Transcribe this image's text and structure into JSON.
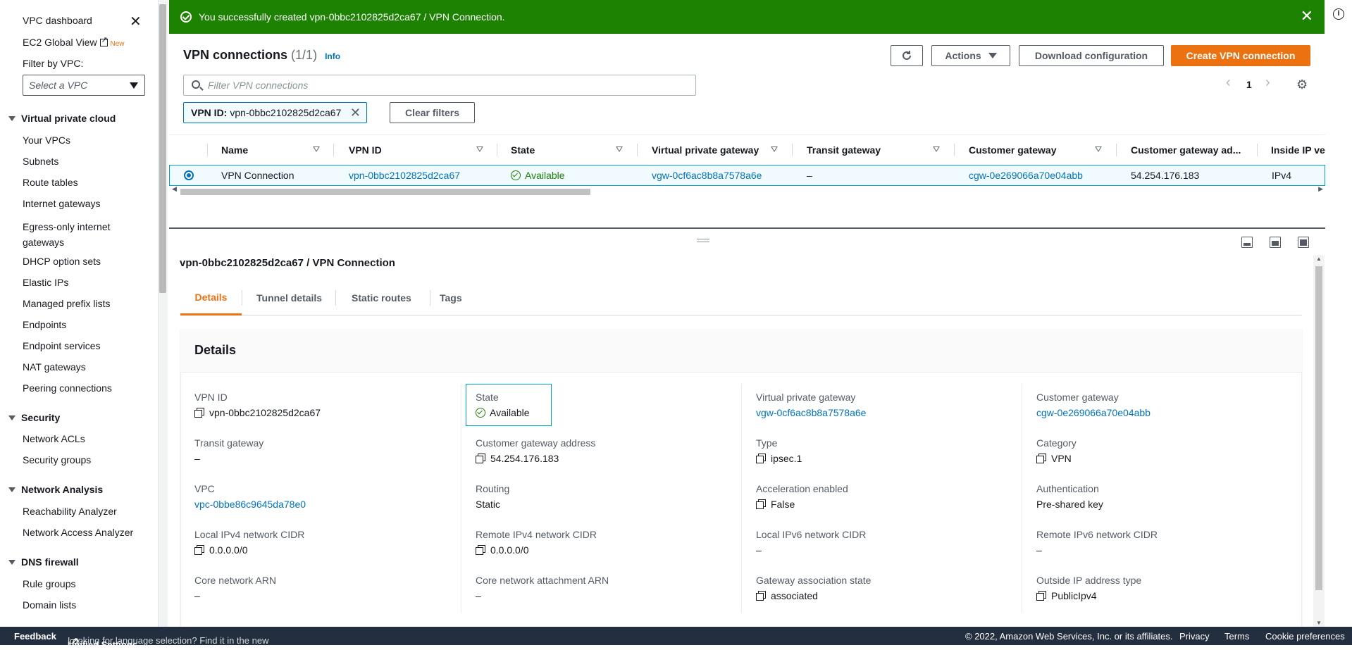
{
  "banner": {
    "message": "You successfully created vpn-0bbc2102825d2ca67 / VPN Connection.",
    "color": "#1d8102"
  },
  "sidebar": {
    "dashboard": "VPC dashboard",
    "ec2_global": "EC2 Global View",
    "new_badge": "New",
    "filter_label": "Filter by VPC:",
    "filter_placeholder": "Select a VPC",
    "sections": [
      {
        "title": "Virtual private cloud",
        "items": [
          "Your VPCs",
          "Subnets",
          "Route tables",
          "Internet gateways",
          "Egress-only internet gateways",
          "DHCP option sets",
          "Elastic IPs",
          "Managed prefix lists",
          "Endpoints",
          "Endpoint services",
          "NAT gateways",
          "Peering connections"
        ]
      },
      {
        "title": "Security",
        "items": [
          "Network ACLs",
          "Security groups"
        ]
      },
      {
        "title": "Network Analysis",
        "items": [
          "Reachability Analyzer",
          "Network Access Analyzer"
        ]
      },
      {
        "title": "DNS firewall",
        "items": [
          "Rule groups",
          "Domain lists"
        ]
      }
    ]
  },
  "header": {
    "title": "VPN connections",
    "count": "(1/1)",
    "info": "Info",
    "actions": "Actions",
    "download": "Download configuration",
    "create": "Create VPN connection",
    "search_placeholder": "Filter VPN connections",
    "page": "1",
    "chip_key": "VPN ID:",
    "chip_value": "vpn-0bbc2102825d2ca67",
    "clear_filters": "Clear filters"
  },
  "table": {
    "columns": [
      "Name",
      "VPN ID",
      "State",
      "Virtual private gateway",
      "Transit gateway",
      "Customer gateway",
      "Customer gateway ad...",
      "Inside IP ve"
    ],
    "row": {
      "name": "VPN Connection",
      "vpn_id": "vpn-0bbc2102825d2ca67",
      "state": "Available",
      "vgw": "vgw-0cf6ac8b8a7578a6e",
      "transit": "–",
      "cgw": "cgw-0e269066a70e04abb",
      "cgw_addr": "54.254.176.183",
      "inside_ip": "IPv4"
    }
  },
  "detail": {
    "title": "vpn-0bbc2102825d2ca67 / VPN Connection",
    "tabs": [
      "Details",
      "Tunnel details",
      "Static routes",
      "Tags"
    ],
    "section_title": "Details",
    "fields": {
      "vpn_id": {
        "label": "VPN ID",
        "value": "vpn-0bbc2102825d2ca67"
      },
      "state": {
        "label": "State",
        "value": "Available"
      },
      "vgw": {
        "label": "Virtual private gateway",
        "value": "vgw-0cf6ac8b8a7578a6e"
      },
      "cgw": {
        "label": "Customer gateway",
        "value": "cgw-0e269066a70e04abb"
      },
      "transit": {
        "label": "Transit gateway",
        "value": "–"
      },
      "cgw_addr": {
        "label": "Customer gateway address",
        "value": "54.254.176.183"
      },
      "type": {
        "label": "Type",
        "value": "ipsec.1"
      },
      "category": {
        "label": "Category",
        "value": "VPN"
      },
      "vpc": {
        "label": "VPC",
        "value": "vpc-0bbe86c9645da78e0"
      },
      "routing": {
        "label": "Routing",
        "value": "Static"
      },
      "accel": {
        "label": "Acceleration enabled",
        "value": "False"
      },
      "auth": {
        "label": "Authentication",
        "value": "Pre-shared key"
      },
      "local4": {
        "label": "Local IPv4 network CIDR",
        "value": "0.0.0.0/0"
      },
      "remote4": {
        "label": "Remote IPv4 network CIDR",
        "value": "0.0.0.0/0"
      },
      "local6": {
        "label": "Local IPv6 network CIDR",
        "value": "–"
      },
      "remote6": {
        "label": "Remote IPv6 network CIDR",
        "value": "–"
      },
      "core_arn": {
        "label": "Core network ARN",
        "value": "–"
      },
      "core_attach": {
        "label": "Core network attachment ARN",
        "value": "–"
      },
      "gw_assoc": {
        "label": "Gateway association state",
        "value": "associated"
      },
      "outside_ip": {
        "label": "Outside IP address type",
        "value": "PublicIpv4"
      }
    }
  },
  "footer": {
    "feedback": "Feedback",
    "lang_text": "Looking for language selection? Find it in the new",
    "unified": "Unified Settings",
    "copyright": "© 2022, Amazon Web Services, Inc. or its affiliates.",
    "privacy": "Privacy",
    "terms": "Terms",
    "cookies": "Cookie preferences"
  },
  "colors": {
    "accent": "#ec7211",
    "link": "#0073bb",
    "success": "#1d8102",
    "footer": "#232f3e"
  }
}
